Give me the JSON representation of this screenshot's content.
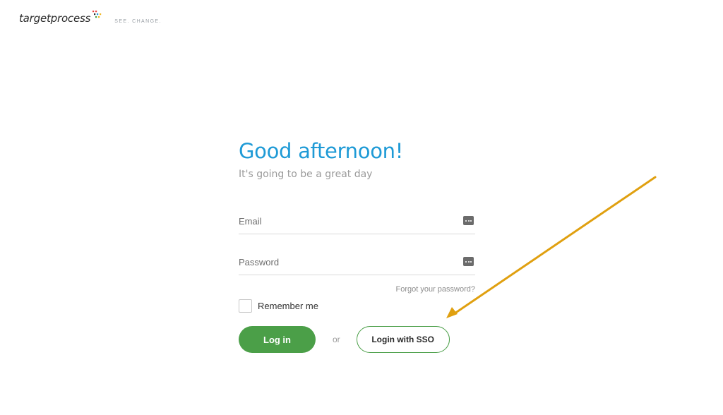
{
  "brand": {
    "name": "targetprocess",
    "tagline": "SEE. CHANGE."
  },
  "greeting": {
    "title": "Good afternoon!",
    "subtitle": "It's going to be a great day"
  },
  "form": {
    "email_placeholder": "Email",
    "password_placeholder": "Password",
    "forgot_password": "Forgot your password?",
    "remember_me": "Remember me",
    "remember_checked": false,
    "login_button": "Log in",
    "or_text": "or",
    "sso_button": "Login with SSO"
  },
  "colors": {
    "title": "#1e9ad6",
    "primary_button": "#4b9f48",
    "annotation_arrow": "#e0a010"
  },
  "icons": {
    "field_icon": "ellipsis-icon",
    "logo": "targetprocess-logo-icon"
  }
}
